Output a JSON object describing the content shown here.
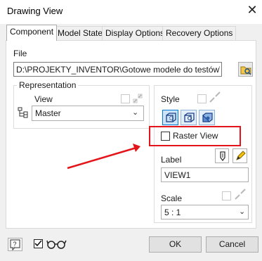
{
  "window": {
    "title": "Drawing View",
    "close_glyph": "✕"
  },
  "tabs": [
    "Component",
    "Model State",
    "Display Options",
    "Recovery Options"
  ],
  "file": {
    "label": "File",
    "path": "D:\\PROJEKTY_INVENTOR\\Gotowe modele do testów\\alpha_r"
  },
  "representation": {
    "label": "Representation",
    "view_label": "View",
    "view_value": "Master"
  },
  "style": {
    "label": "Style",
    "raster_view_label": "Raster View",
    "raster_view_checked": false
  },
  "label_section": {
    "label": "Label",
    "value": "VIEW1"
  },
  "scale": {
    "label": "Scale",
    "value": "5 : 1"
  },
  "buttons": {
    "ok": "OK",
    "cancel": "Cancel"
  },
  "icons": {
    "browse": "open-folder-icon",
    "view_tree": "tree-structure-icon",
    "link": "link-broken-icon",
    "help": "help-icon",
    "glasses": "glasses-icon",
    "style_hidden": "hidden-line-style-icon",
    "style_hidden_removed": "hidden-line-removed-style-icon",
    "style_shaded": "shaded-style-icon",
    "toggle_label": "label-visibility-icon",
    "edit_label": "pencil-icon",
    "arrow": "red-annotation-arrow"
  },
  "colors": {
    "accent": "#0078d7",
    "annotation_red": "#e3151a"
  },
  "chk_bottom_checked": true
}
